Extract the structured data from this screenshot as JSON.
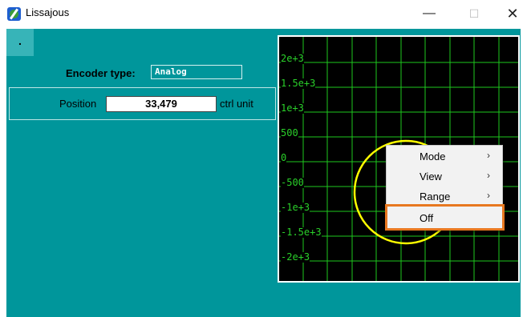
{
  "window": {
    "title": "Lissajous",
    "minimize": "—",
    "maximize": "☐",
    "close": "✕"
  },
  "toolbar": {
    "dot_button": "."
  },
  "encoder": {
    "label": "Encoder type:",
    "value": "Analog"
  },
  "position": {
    "label": "Position",
    "value": "33,479",
    "unit": "ctrl unit"
  },
  "plot": {
    "y_ticks": [
      "2e+3",
      "1.5e+3",
      "1e+3",
      "500",
      "0",
      "-500",
      "-1e+3",
      "-1.5e+3",
      "-2e+3"
    ],
    "colors": {
      "background": "#000000",
      "grid": "#1ec81e",
      "trace": "#ffff00"
    }
  },
  "context_menu": {
    "items": [
      {
        "label": "Mode",
        "arrow": "›"
      },
      {
        "label": "View",
        "arrow": "›"
      },
      {
        "label": "Range",
        "arrow": "›"
      },
      {
        "label": "Off",
        "arrow": ""
      }
    ],
    "highlight_color": "#e87820"
  }
}
